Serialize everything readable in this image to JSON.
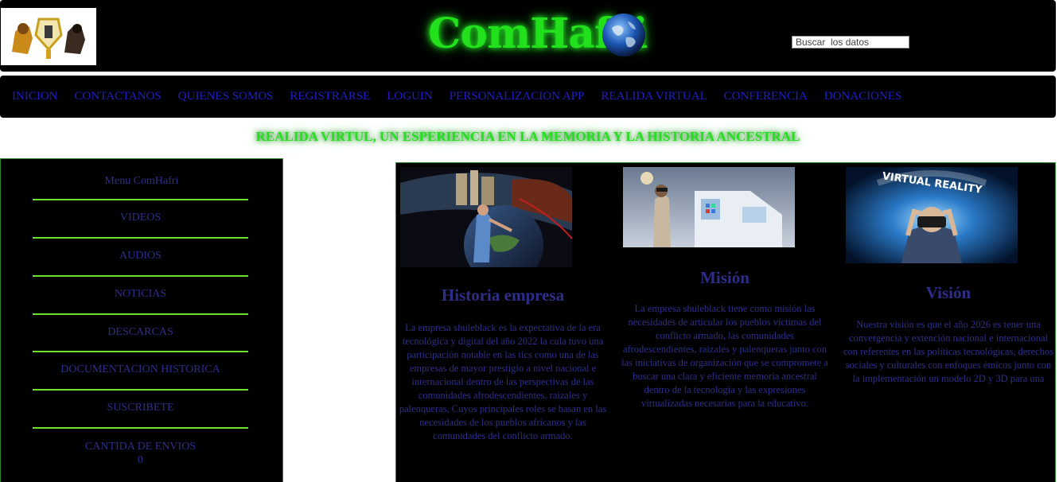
{
  "header": {
    "brand": "ComHafri",
    "search_placeholder": "Buscar  los datos",
    "logo": "comhafri-emblem"
  },
  "nav": {
    "items": [
      "INICION",
      "CONTACTANOS",
      "QUIENES SOMOS",
      "REGISTRARSE",
      "LOGUIN",
      "PERSONALIZACION APP",
      "REALIDA VIRTUAL",
      "CONFERENCIA",
      "DONACIONES"
    ]
  },
  "headline": "REALIDA VIRTUL, UN ESPERIENCIA EN LA MEMORIA Y LA HISTORIA ANCESTRAL",
  "sidebar": {
    "title": "Menu ComHafri",
    "items": [
      "VIDEOS",
      "AUDIOS",
      "NOTICIAS",
      "DESCARCAS",
      "DOCUMENTACION HISTORICA",
      "SUSCRIBETE",
      "CANTIDA DE ENVIOS"
    ],
    "count": "0"
  },
  "cards": [
    {
      "title": "Historia empresa",
      "text": "La empresa shuleblack es la expectativa de la era tecnológica y digital del año 2022 la cula tuvo una participación notable en las tics como una de las empresas de mayor prestigio a nivel nacional e internacional dentro de las perspectivas de las comunidades afrodescendientes, raizales y palenqueras, Cuyos principales roles se basan en las necesidades de los pueblos africanos y las comunidades del conflicto armado."
    },
    {
      "title": "Misión",
      "text": "La empresa shuleblack tiene como misión las necesidades de articular los pueblos víctimas del conflicto armado, las comunidades afrodescendientes, raizales y palenqueras junto con las iniciativas de organización que se compromete a buscar una clara y eficiente memoria ancestral dentro de la tecnología y las expresiones virtualizadas necesarias para la educativo."
    },
    {
      "title": "Visión",
      "text": "Nuestra visión es que el año 2026 es tener una convergencia y extención nacional e internacional con referentes en las políticas tecnológicas, derechos sociales y culturales con enfoques étnicos junto con la implementación un modelo 2D y 3D para una",
      "image_caption": "VIRTUAL REALITY"
    }
  ],
  "colors": {
    "brand_green": "#22e01c",
    "nav_link": "#1f1fc8",
    "body_text": "#2e2e8a",
    "divider": "#6ee22a"
  }
}
